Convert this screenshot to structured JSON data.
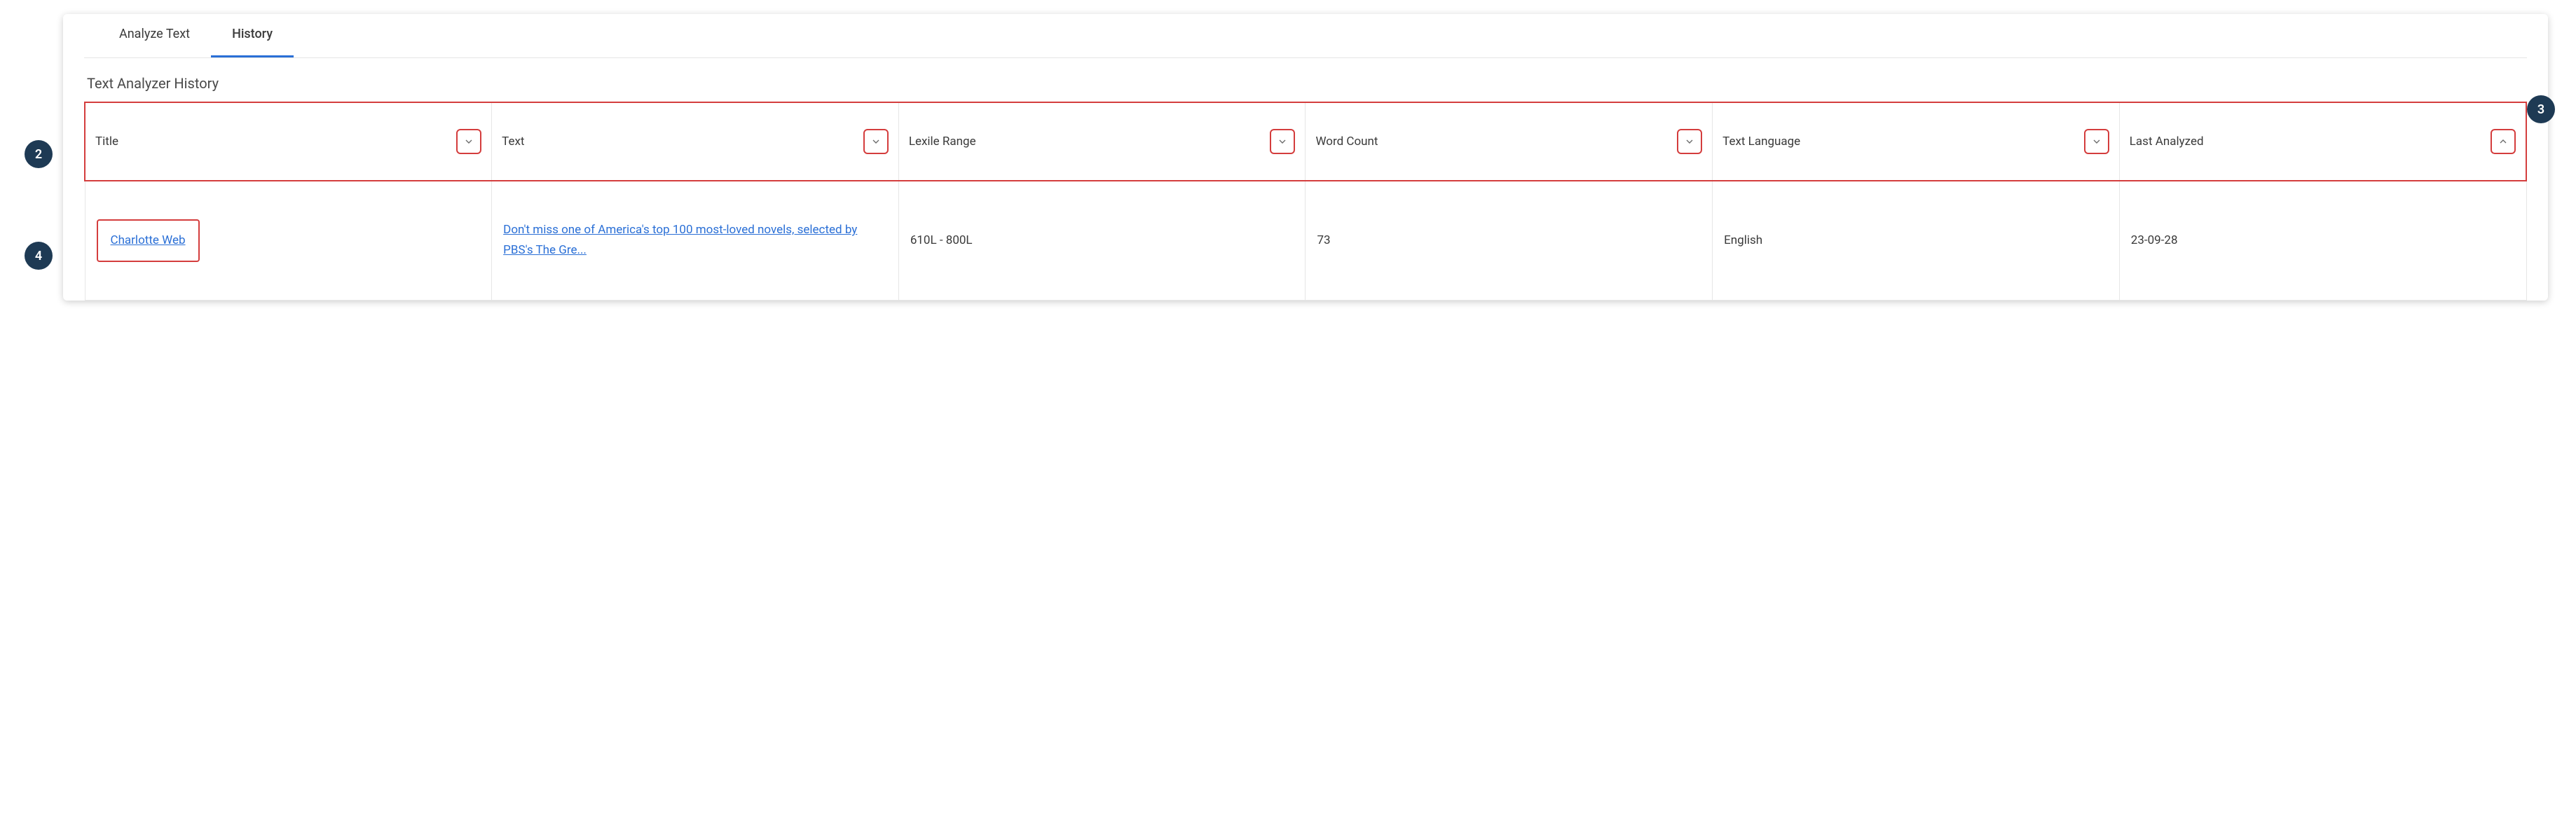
{
  "callouts": {
    "c2": "2",
    "c3": "3",
    "c4": "4"
  },
  "tabs": {
    "analyze": "Analyze Text",
    "history": "History"
  },
  "page_title": "Text Analyzer History",
  "columns": {
    "title": "Title",
    "text": "Text",
    "lexile": "Lexile Range",
    "wordcount": "Word Count",
    "language": "Text Language",
    "last_analyzed": "Last Analyzed"
  },
  "rows": [
    {
      "title": "Charlotte Web",
      "text": "Don't miss one of America's top 100 most-loved novels, selected by PBS's The Gre...",
      "lexile": "610L - 800L",
      "wordcount": "73",
      "language": "English",
      "last_analyzed": "23-09-28"
    }
  ]
}
